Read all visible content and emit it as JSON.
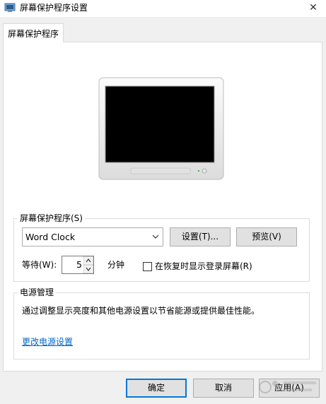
{
  "window": {
    "title": "屏幕保护程序设置",
    "icons": {
      "app": "screensaver-app-icon",
      "close": "close-icon"
    }
  },
  "tabs": [
    {
      "label": "屏幕保护程序",
      "selected": true
    }
  ],
  "screensaver": {
    "group_label": "屏幕保护程序(S)",
    "selected": "Word Clock",
    "settings_button": "设置(T)...",
    "preview_button": "预览(V)",
    "wait_label": "等待(W):",
    "wait_value": "5",
    "wait_unit": "分钟",
    "resume_checkbox_label": "在恢复时显示登录屏幕(R)",
    "resume_checked": false
  },
  "power": {
    "group_label": "电源管理",
    "description": "通过调整显示亮度和其他电源设置以节省能源或提供最佳性能。",
    "link": "更改电源设置"
  },
  "footer": {
    "ok": "确定",
    "cancel": "取消",
    "apply": "应用(A)"
  },
  "colors": {
    "accent": "#0078d7",
    "link": "#0066cc",
    "panel": "#ffffff",
    "window": "#f0f0f0"
  }
}
